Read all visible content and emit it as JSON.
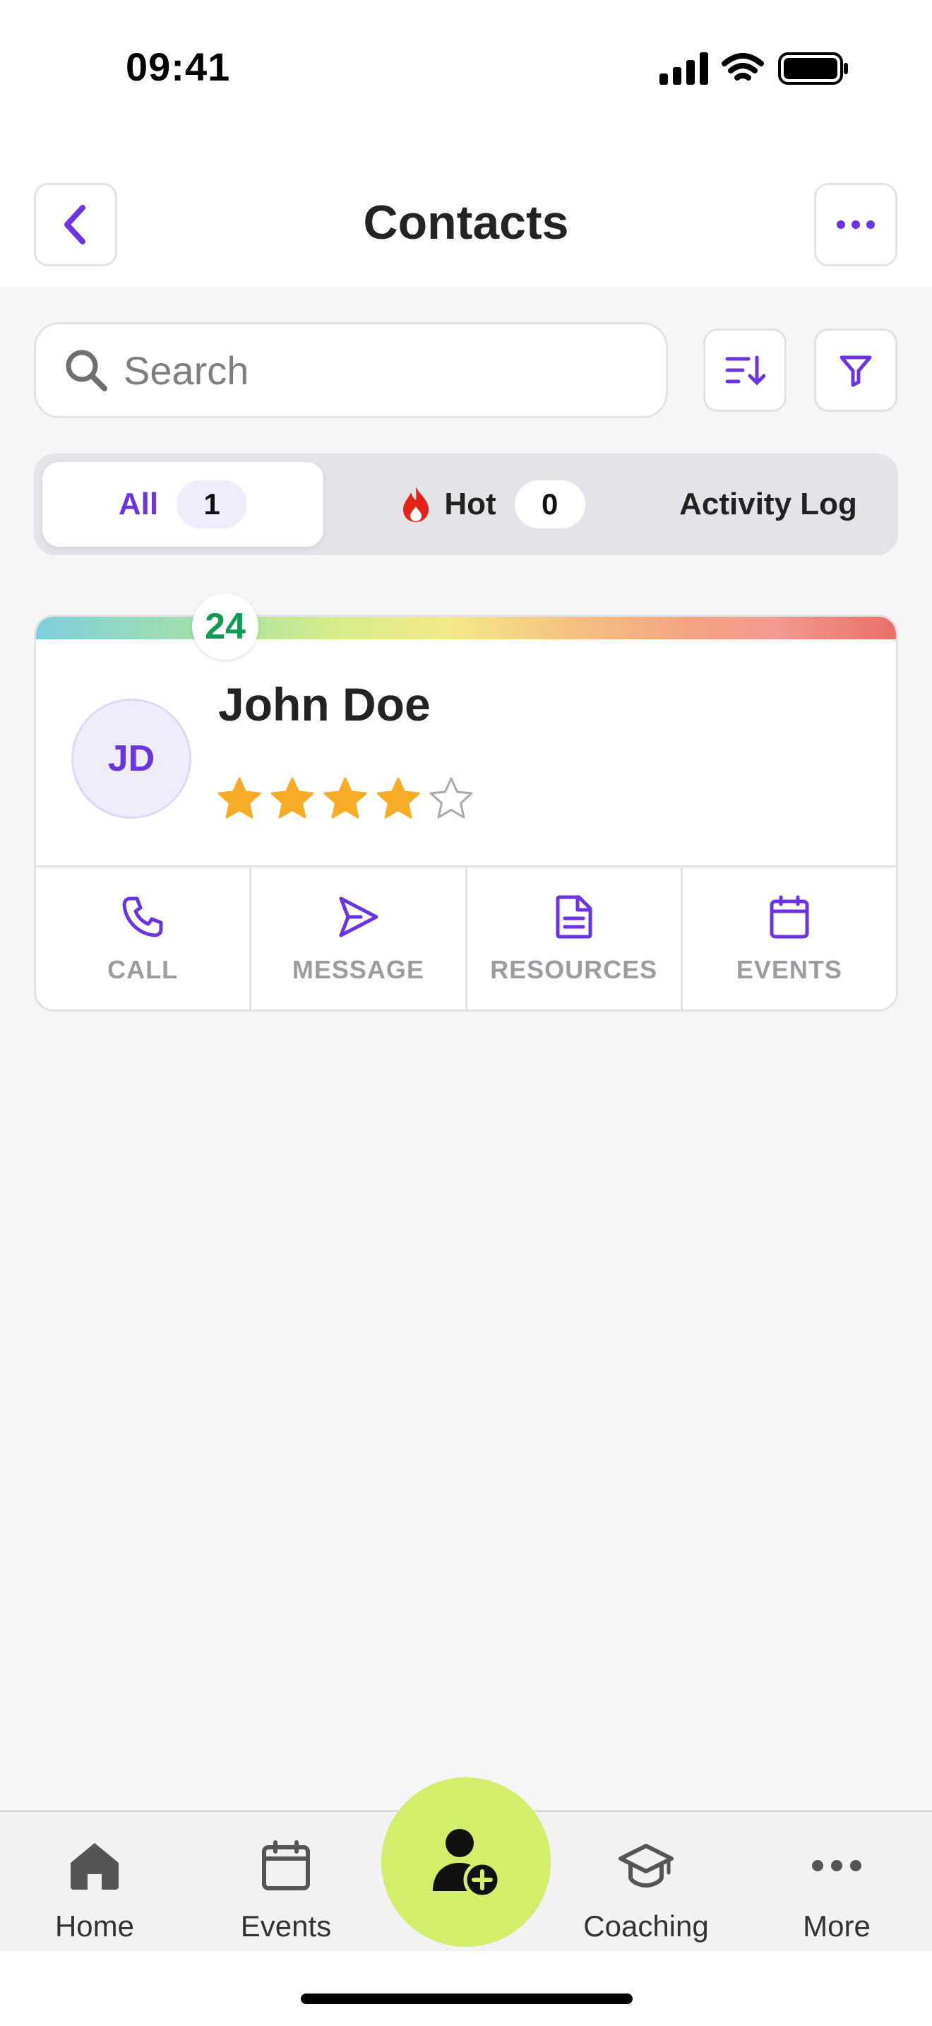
{
  "status_bar": {
    "time": "09:41"
  },
  "header": {
    "title": "Contacts"
  },
  "search": {
    "placeholder": "Search",
    "value": ""
  },
  "tabs": [
    {
      "label": "All",
      "count": "1",
      "active": true
    },
    {
      "label": "Hot",
      "count": "0",
      "icon": "flame-icon"
    },
    {
      "label": "Activity Log"
    }
  ],
  "contact": {
    "name": "John Doe",
    "initials": "JD",
    "score": "24",
    "rating": 4,
    "rating_max": 5,
    "actions": [
      {
        "label": "CALL",
        "icon": "phone-icon"
      },
      {
        "label": "MESSAGE",
        "icon": "send-icon"
      },
      {
        "label": "RESOURCES",
        "icon": "document-icon"
      },
      {
        "label": "EVENTS",
        "icon": "calendar-icon"
      }
    ]
  },
  "bottom_nav": [
    {
      "label": "Home",
      "icon": "home-icon"
    },
    {
      "label": "Events",
      "icon": "calendar-icon"
    },
    {
      "label": "Coaching",
      "icon": "graduation-cap-icon"
    },
    {
      "label": "More",
      "icon": "more-dots-icon"
    }
  ],
  "colors": {
    "accent": "#6a35e0",
    "score_text": "#109a55",
    "star_filled": "#f7ab26",
    "fab": "#d3ee6a",
    "flame": "#e52218"
  }
}
